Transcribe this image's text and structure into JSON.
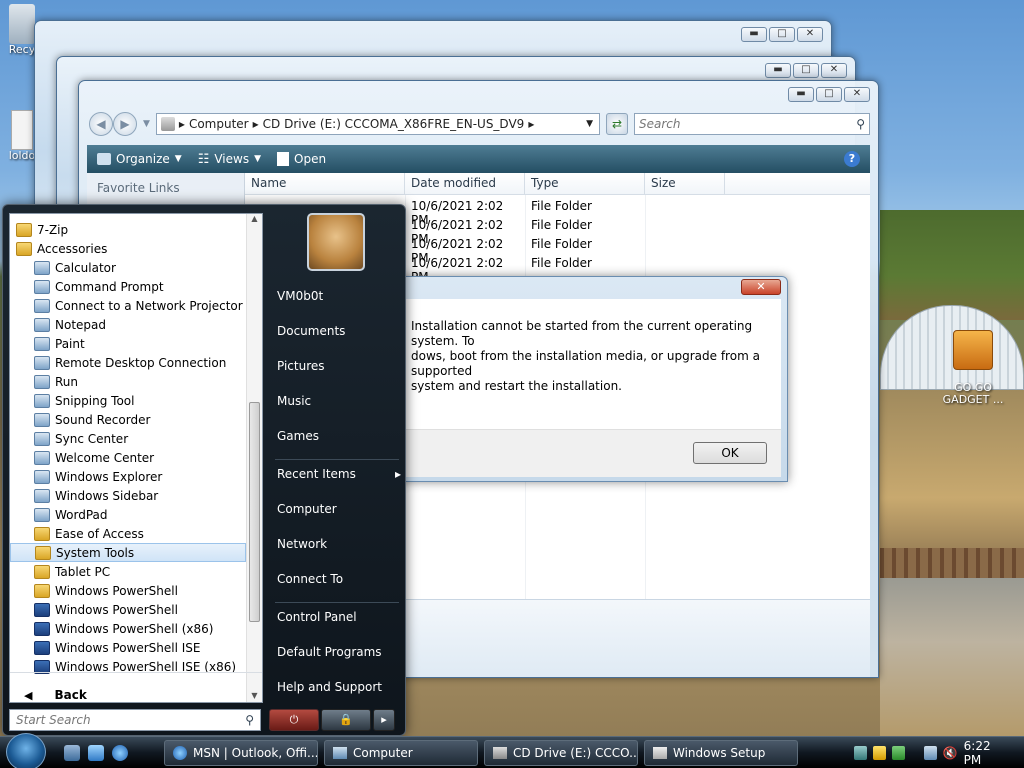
{
  "desktop": {
    "icons": [
      {
        "label": "Recy"
      },
      {
        "label": "loldo"
      },
      {
        "label": "GO GO\nGADGET ..."
      }
    ]
  },
  "explorer": {
    "address": [
      "Computer",
      "CD Drive (E:) CCCOMA_X86FRE_EN-US_DV9"
    ],
    "search_placeholder": "Search",
    "toolbar": {
      "organize": "Organize",
      "views": "Views",
      "open": "Open"
    },
    "favorite_links": "Favorite Links",
    "columns": [
      "Name",
      "Date modified",
      "Type",
      "Size"
    ],
    "rows": [
      {
        "date": "10/6/2021 2:02 PM",
        "type": "File Folder"
      },
      {
        "date": "10/6/2021 2:02 PM",
        "type": "File Folder"
      },
      {
        "date": "10/6/2021 2:02 PM",
        "type": "File Folder"
      },
      {
        "date": "10/6/2021 2:02 PM",
        "type": "File Folder"
      }
    ],
    "trailing": [
      "M",
      "M"
    ]
  },
  "dialog": {
    "message_lines": [
      "Installation cannot be started from the current operating system. To",
      "dows, boot from the installation media, or upgrade from a supported",
      "system and restart the installation."
    ],
    "ok": "OK"
  },
  "start_menu": {
    "programs": [
      {
        "label": "7-Zip",
        "icon": "folder",
        "indent": 0
      },
      {
        "label": "Accessories",
        "icon": "folder",
        "indent": 0
      },
      {
        "label": "Calculator",
        "icon": "calculator-icon",
        "indent": 1
      },
      {
        "label": "Command Prompt",
        "icon": "command-prompt-icon",
        "indent": 1
      },
      {
        "label": "Connect to a Network Projector",
        "icon": "projector-icon",
        "indent": 1
      },
      {
        "label": "Notepad",
        "icon": "notepad-icon",
        "indent": 1
      },
      {
        "label": "Paint",
        "icon": "paint-icon",
        "indent": 1
      },
      {
        "label": "Remote Desktop Connection",
        "icon": "remote-desktop-icon",
        "indent": 1
      },
      {
        "label": "Run",
        "icon": "run-icon",
        "indent": 1
      },
      {
        "label": "Snipping Tool",
        "icon": "scissors-icon",
        "indent": 1
      },
      {
        "label": "Sound Recorder",
        "icon": "microphone-icon",
        "indent": 1
      },
      {
        "label": "Sync Center",
        "icon": "sync-icon",
        "indent": 1
      },
      {
        "label": "Welcome Center",
        "icon": "welcome-icon",
        "indent": 1
      },
      {
        "label": "Windows Explorer",
        "icon": "explorer-icon",
        "indent": 1
      },
      {
        "label": "Windows Sidebar",
        "icon": "sidebar-icon",
        "indent": 1
      },
      {
        "label": "WordPad",
        "icon": "wordpad-icon",
        "indent": 1
      },
      {
        "label": "Ease of Access",
        "icon": "folder",
        "indent": 1
      },
      {
        "label": "System Tools",
        "icon": "folder",
        "indent": 1,
        "selected": true
      },
      {
        "label": "Tablet PC",
        "icon": "folder",
        "indent": 1
      },
      {
        "label": "Windows PowerShell",
        "icon": "folder",
        "indent": 1
      },
      {
        "label": "Windows PowerShell",
        "icon": "powershell-icon",
        "indent": 2
      },
      {
        "label": "Windows PowerShell (x86)",
        "icon": "powershell-icon",
        "indent": 2
      },
      {
        "label": "Windows PowerShell ISE",
        "icon": "powershell-icon",
        "indent": 2
      },
      {
        "label": "Windows PowerShell ISE (x86)",
        "icon": "powershell-icon",
        "indent": 2
      }
    ],
    "back": "Back",
    "search_placeholder": "Start Search",
    "user": "VM0b0t",
    "right_items": [
      "Documents",
      "Pictures",
      "Music",
      "Games",
      "Recent Items",
      "Computer",
      "Network",
      "Connect To",
      "Control Panel",
      "Default Programs",
      "Help and Support"
    ]
  },
  "taskbar": {
    "buttons": [
      "MSN | Outlook, Offi...",
      "Computer",
      "CD Drive (E:) CCCO...",
      "Windows Setup"
    ],
    "clock": "6:22 PM"
  }
}
